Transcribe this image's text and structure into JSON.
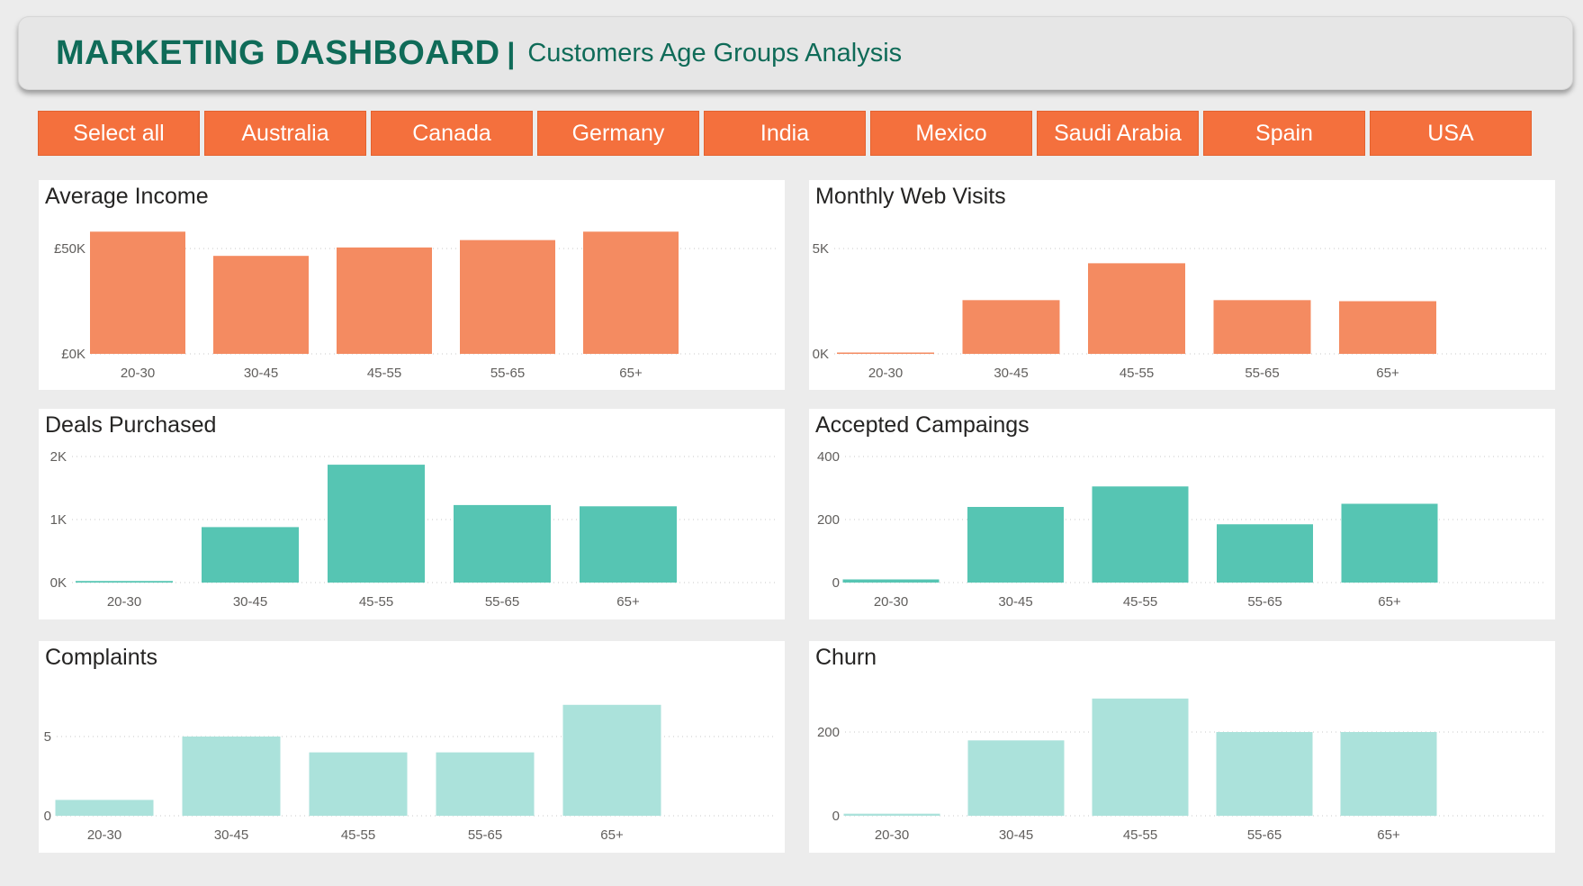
{
  "header": {
    "title": "MARKETING DASHBOARD",
    "separator": "|",
    "subtitle": "Customers Age Groups Analysis"
  },
  "slicer": {
    "items": [
      "Select all",
      "Australia",
      "Canada",
      "Germany",
      "India",
      "Mexico",
      "Saudi Arabia",
      "Spain",
      "USA"
    ]
  },
  "colors": {
    "accent": "#f4703d",
    "title": "#0f6b58",
    "orange_bar": "#f48b61",
    "teal_bar": "#56c5b3",
    "light_teal_bar": "#abe2db"
  },
  "chart_data": [
    {
      "type": "bar",
      "title": "Average Income",
      "color": "#f48b61",
      "categories": [
        "20-30",
        "30-45",
        "45-55",
        "55-65",
        "65+"
      ],
      "values": [
        58000,
        46500,
        50500,
        54000,
        58000
      ],
      "ylim": [
        0,
        50000
      ],
      "yticks": [
        0,
        50000
      ],
      "ytick_labels": [
        "£0K",
        "£50K"
      ],
      "grid": true
    },
    {
      "type": "bar",
      "title": "Monthly Web Visits",
      "color": "#f48b61",
      "categories": [
        "20-30",
        "30-45",
        "45-55",
        "55-65",
        "65+"
      ],
      "values": [
        50,
        2550,
        4300,
        2550,
        2500
      ],
      "ylim": [
        0,
        5000
      ],
      "yticks": [
        0,
        5000
      ],
      "ytick_labels": [
        "0K",
        "5K"
      ],
      "grid": true
    },
    {
      "type": "bar",
      "title": "Deals Purchased",
      "color": "#56c5b3",
      "categories": [
        "20-30",
        "30-45",
        "45-55",
        "55-65",
        "65+"
      ],
      "values": [
        25,
        880,
        1870,
        1230,
        1210
      ],
      "ylim": [
        0,
        2000
      ],
      "yticks": [
        0,
        1000,
        2000
      ],
      "ytick_labels": [
        "0K",
        "1K",
        "2K"
      ],
      "grid": true
    },
    {
      "type": "bar",
      "title": "Accepted Campaings",
      "color": "#56c5b3",
      "categories": [
        "20-30",
        "30-45",
        "45-55",
        "55-65",
        "65+"
      ],
      "values": [
        10,
        240,
        305,
        185,
        250
      ],
      "ylim": [
        0,
        400
      ],
      "yticks": [
        0,
        200,
        400
      ],
      "ytick_labels": [
        "0",
        "200",
        "400"
      ],
      "grid": true
    },
    {
      "type": "bar",
      "title": "Complaints",
      "color": "#abe2db",
      "categories": [
        "20-30",
        "30-45",
        "45-55",
        "55-65",
        "65+"
      ],
      "values": [
        1,
        5,
        4,
        4,
        7
      ],
      "ylim": [
        0,
        5
      ],
      "yticks": [
        0,
        5
      ],
      "ytick_labels": [
        "0",
        "5"
      ],
      "grid": true
    },
    {
      "type": "bar",
      "title": "Churn",
      "color": "#abe2db",
      "categories": [
        "20-30",
        "30-45",
        "45-55",
        "55-65",
        "65+"
      ],
      "values": [
        5,
        180,
        280,
        200,
        200
      ],
      "ylim": [
        0,
        200
      ],
      "yticks": [
        0,
        200
      ],
      "ytick_labels": [
        "0",
        "200"
      ],
      "grid": true
    }
  ]
}
